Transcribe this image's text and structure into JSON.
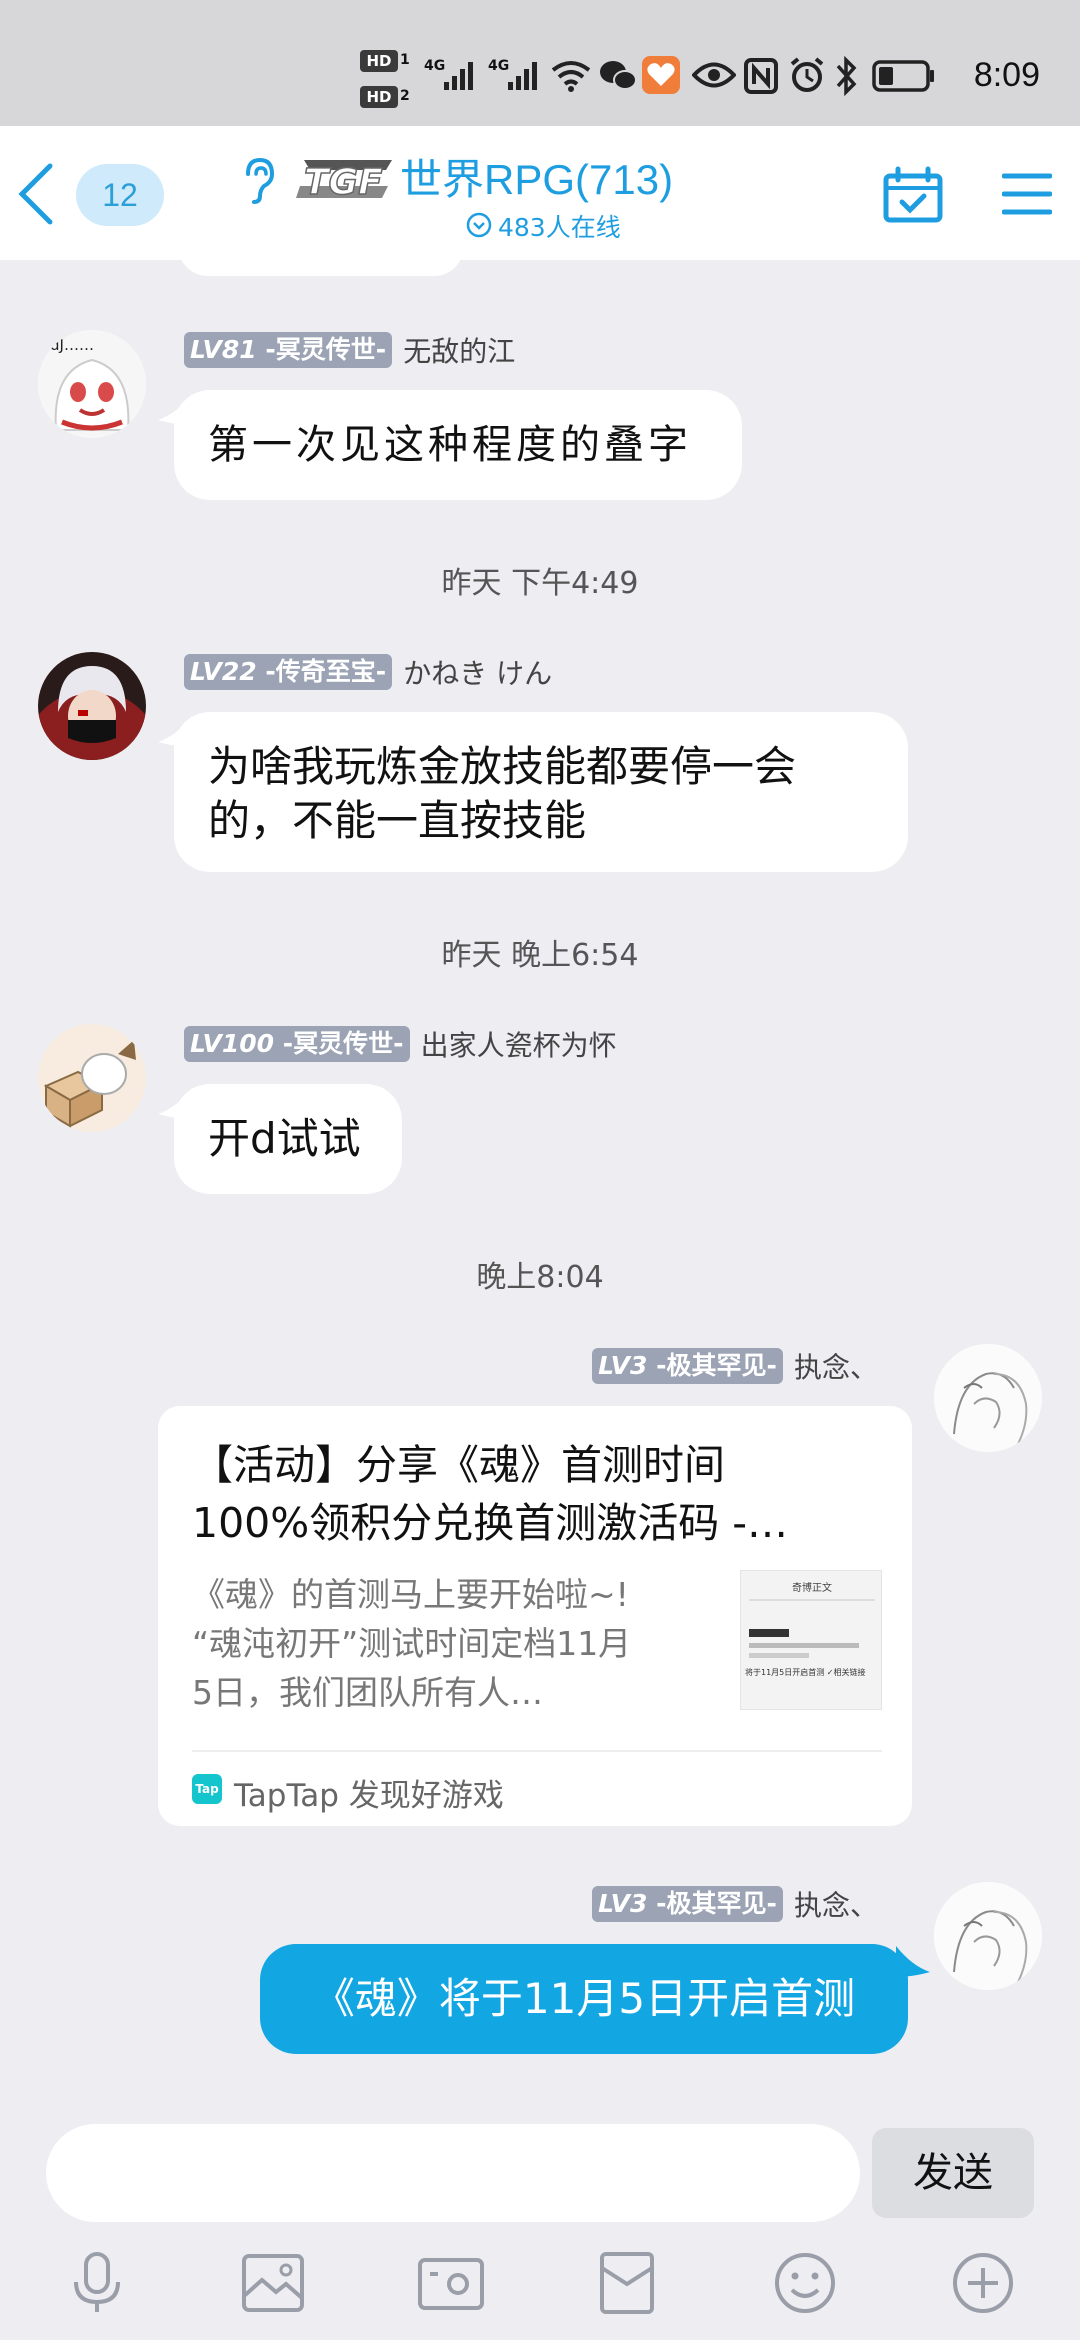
{
  "status_bar": {
    "hd1": "HD",
    "hd1_num": "1",
    "hd2": "HD",
    "hd2_num": "2",
    "signal1": "4G",
    "signal2": "4G",
    "time": "8:09"
  },
  "header": {
    "unread_count": "12",
    "logo_text": "TGF",
    "group_title": "世界RPG(713)",
    "online_text": "483人在线"
  },
  "messages": [
    {
      "avatar_text": "dJ……",
      "level": "LV81",
      "rank": "-冥灵传世-",
      "nickname": "无敌的江",
      "text": "第一次见这种程度的叠字"
    },
    {
      "level": "LV22",
      "rank": "-传奇至宝-",
      "nickname": "かねき けん",
      "text_line1": "为啥我玩炼金放技能都要停一会",
      "text_line2": "的，不能一直按技能"
    },
    {
      "level": "LV100",
      "rank": "-冥灵传世-",
      "nickname": "出家人瓷杯为怀",
      "text": "开d试试"
    },
    {
      "level": "LV3",
      "rank": "-极其罕见-",
      "nickname": "执念、",
      "card": {
        "title_line1": "【活动】分享《魂》首测时间",
        "title_line2": "100%领积分兑换首测激活码 -…",
        "desc_line1": "《魂》的首测马上要开始啦~!",
        "desc_line2": "“魂沌初开”测试时间定档11月",
        "desc_line3": "5日，我们团队所有人…",
        "thumb_title": "奇博正文",
        "thumb_line1": "将于11月5日开启首测 ✓相关链接",
        "source_icon": "Tap",
        "source": "TapTap 发现好游戏"
      }
    },
    {
      "level": "LV3",
      "rank": "-极其罕见-",
      "nickname": "执念、",
      "text": "《魂》将于11月5日开启首测"
    }
  ],
  "timestamps": [
    "昨天 下午4:49",
    "昨天 晚上6:54",
    "晚上8:04"
  ],
  "composer": {
    "input_value": "",
    "send_label": "发送"
  },
  "toolbar": [
    "microphone-icon",
    "image-icon",
    "camera-icon",
    "red-packet-icon",
    "emoji-icon",
    "plus-icon"
  ],
  "colors": {
    "accent": "#1e9ee0",
    "bubble_blue": "#12a6e3",
    "badge_gray": "#9ba3b4",
    "background": "#ededf2"
  }
}
